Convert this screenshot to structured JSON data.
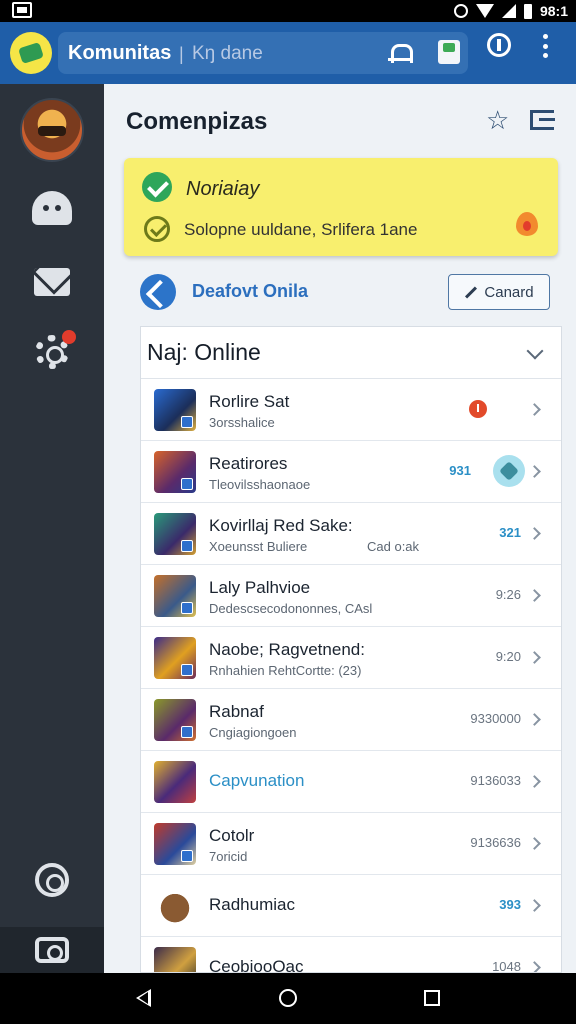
{
  "status_bar": {
    "time": "98:1"
  },
  "app_bar": {
    "title": "Komunitas",
    "separator": "|",
    "subtitle": "Kŋ dane",
    "icons": [
      "bell-icon",
      "store-icon",
      "info-icon",
      "more-icon"
    ]
  },
  "sidebar": {
    "items": [
      {
        "name": "avatar"
      },
      {
        "name": "ghost-icon"
      },
      {
        "name": "mail-icon"
      },
      {
        "name": "gear-icon",
        "badge": true
      },
      {
        "name": "support-icon"
      },
      {
        "name": "camera-icon"
      }
    ]
  },
  "main": {
    "title": "Comenpizas",
    "notice": {
      "title": "Noriaiay",
      "text": "Solopne uuldane, Srlifera 1ane",
      "background": "#f8ef6e"
    },
    "status": {
      "label": "Deafovt Onila",
      "button_label": "Canard"
    },
    "list": {
      "title": "Naj: Online",
      "rows": [
        {
          "name": "Rorlire Sat",
          "sub": "3orsshalice",
          "meta": "",
          "extra": "",
          "indicator": "alert-dot"
        },
        {
          "name": "Reatirores",
          "sub": "Tleovilsshaonaoe",
          "meta": "931",
          "extra": "",
          "indicator": "badge-bubble"
        },
        {
          "name": "Kovirllaj Red Sake:",
          "sub": "Xoeunsst Buliere",
          "meta": "321",
          "extra": "Cad o:ak",
          "indicator": ""
        },
        {
          "name": "Laly Palhvioe",
          "sub": "Dedescsecodononnes, CAsl",
          "meta": "9:26",
          "extra": "",
          "indicator": ""
        },
        {
          "name": "Naobe; Ragvetnend:",
          "sub": "Rnhahien RehtCortte: (23)",
          "meta": "9:20",
          "extra": "",
          "indicator": ""
        },
        {
          "name": "Rabnaf",
          "sub": "Cngiagiongoen",
          "meta": "9330000",
          "extra": "",
          "indicator": ""
        },
        {
          "name": "Capvunation",
          "sub": "",
          "meta": "9136033",
          "extra": "",
          "indicator": ""
        },
        {
          "name": "Cotolr",
          "sub": "7oricid",
          "meta": "9136636",
          "extra": "",
          "indicator": ""
        },
        {
          "name": "Radhumiac",
          "sub": "",
          "meta": "393",
          "extra": "",
          "indicator": ""
        },
        {
          "name": "CeobiooOac",
          "sub": "",
          "meta": "1048",
          "extra": "",
          "indicator": ""
        }
      ]
    }
  },
  "colors": {
    "appbar": "#1f5ea8",
    "rail": "#2b323b",
    "accent": "#2c74c9",
    "link": "#2b8fc6"
  }
}
